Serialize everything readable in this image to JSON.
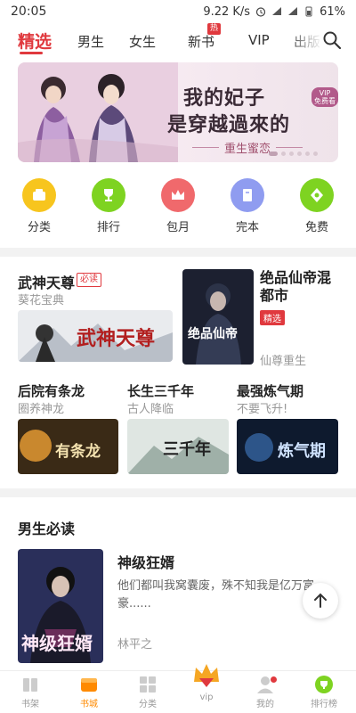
{
  "status": {
    "time": "20:05",
    "speed": "9.22 K/s",
    "battery": "61%"
  },
  "nav": {
    "tabs": [
      "精选",
      "男生",
      "女生",
      "新书",
      "VIP",
      "出版"
    ],
    "hot_badge": "热",
    "search_icon": "search-icon"
  },
  "banner": {
    "line1": "我的妃子",
    "line2": "是穿越過來的",
    "free_badge_1": "VIP",
    "free_badge_2": "免费看",
    "subtitle": "重生蜜恋"
  },
  "quick": [
    {
      "label": "分类",
      "color": "#f7c51e",
      "icon": "category-icon"
    },
    {
      "label": "排行",
      "color": "#7ed321",
      "icon": "trophy-icon"
    },
    {
      "label": "包月",
      "color": "#f0696c",
      "icon": "crown-icon"
    },
    {
      "label": "完本",
      "color": "#8f9cf0",
      "icon": "book-icon"
    },
    {
      "label": "免费",
      "color": "#7ed321",
      "icon": "free-icon"
    }
  ],
  "featured": {
    "main": {
      "title": "武神天尊",
      "tag": "必读",
      "author": "葵花宝典",
      "cover_text": "武神天尊"
    },
    "side": {
      "title": "绝品仙帝混都市",
      "tag": "精选",
      "author": "仙尊重生",
      "cover_text": "绝品仙帝"
    },
    "row": [
      {
        "title": "后院有条龙",
        "author": "圈养神龙",
        "cover_text": "有条龙"
      },
      {
        "title": "长生三千年",
        "author": "古人降临",
        "cover_text": "三千年"
      },
      {
        "title": "最强炼气期",
        "author": "不要飞升!",
        "cover_text": "炼气期"
      }
    ]
  },
  "section": {
    "title": "男生必读",
    "book": {
      "title": "神级狂婿",
      "desc": "他们都叫我窝囊废，殊不知我是亿万富豪......",
      "author": "林平之",
      "cover_text": "神级狂婿"
    }
  },
  "bottom": [
    {
      "label": "书架",
      "icon": "bookshelf-icon"
    },
    {
      "label": "书城",
      "icon": "bookstore-icon"
    },
    {
      "label": "分类",
      "icon": "grid-icon"
    },
    {
      "label": "vip",
      "icon": "vip-crown-icon"
    },
    {
      "label": "我的",
      "icon": "profile-icon"
    },
    {
      "label": "排行榜",
      "icon": "ranking-icon"
    }
  ]
}
